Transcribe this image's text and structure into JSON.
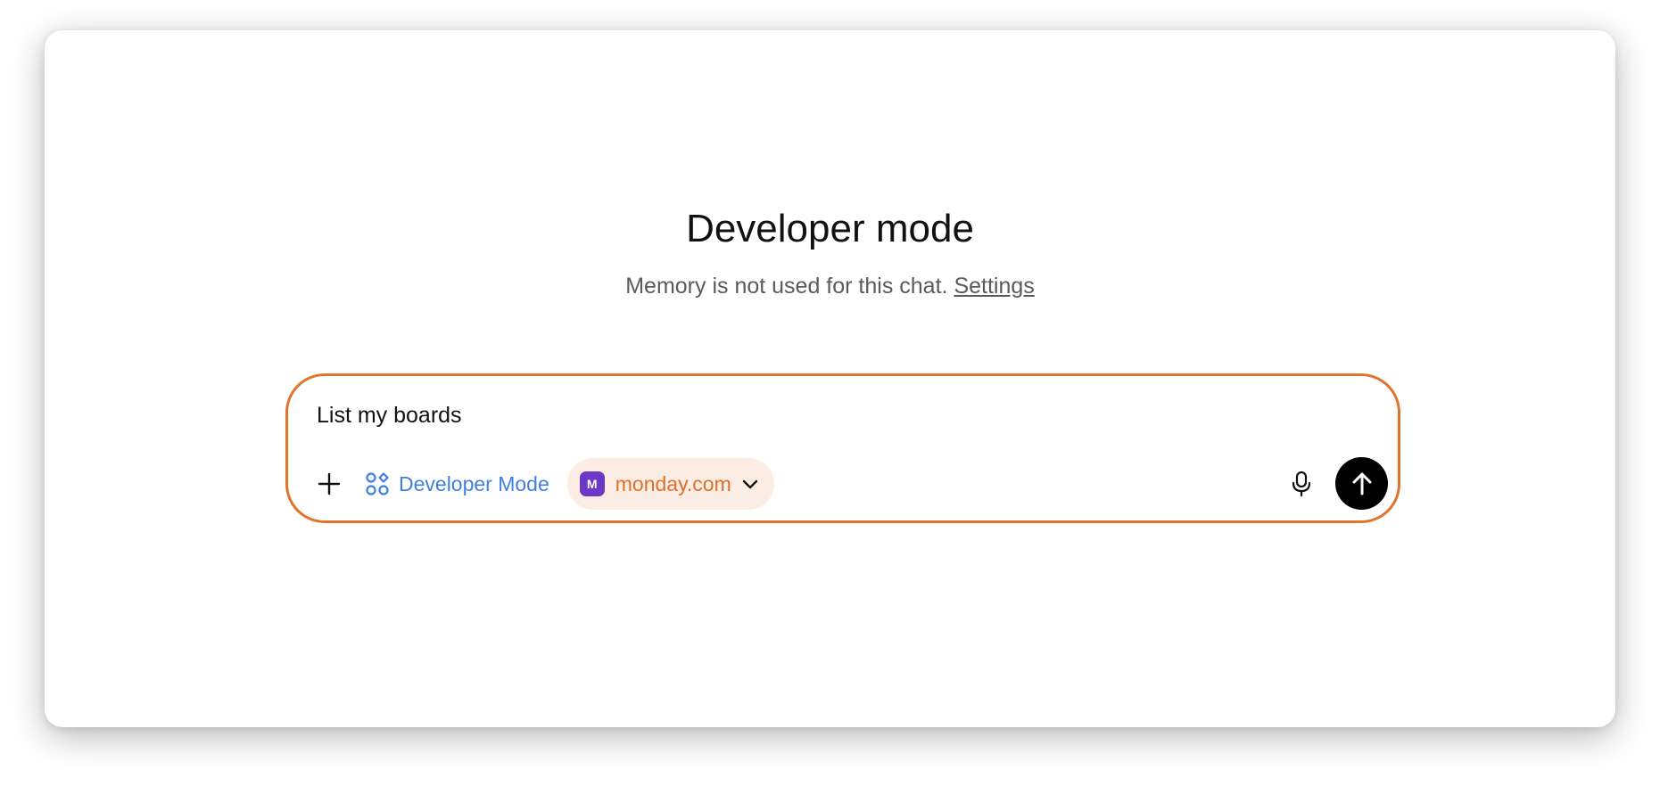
{
  "page": {
    "title": "Developer mode",
    "memory_notice": "Memory is not used for this chat.",
    "settings_link": "Settings"
  },
  "composer": {
    "input_text": "List my boards",
    "add_icon": "plus-icon",
    "developer_mode": {
      "icon": "apps-icon",
      "label": "Developer Mode"
    },
    "connector_chip": {
      "badge_letter": "M",
      "label": "monday.com",
      "dropdown_icon": "chevron-down-icon"
    },
    "mic_icon": "microphone-icon",
    "send_icon": "arrow-up-icon"
  },
  "colors": {
    "focus_border": "#e0742c",
    "developer_mode_text": "#3f7fe3",
    "chip_background": "#fbede3",
    "chip_text": "#dd7028",
    "badge_background": "#6b37c4",
    "send_button": "#000000"
  }
}
